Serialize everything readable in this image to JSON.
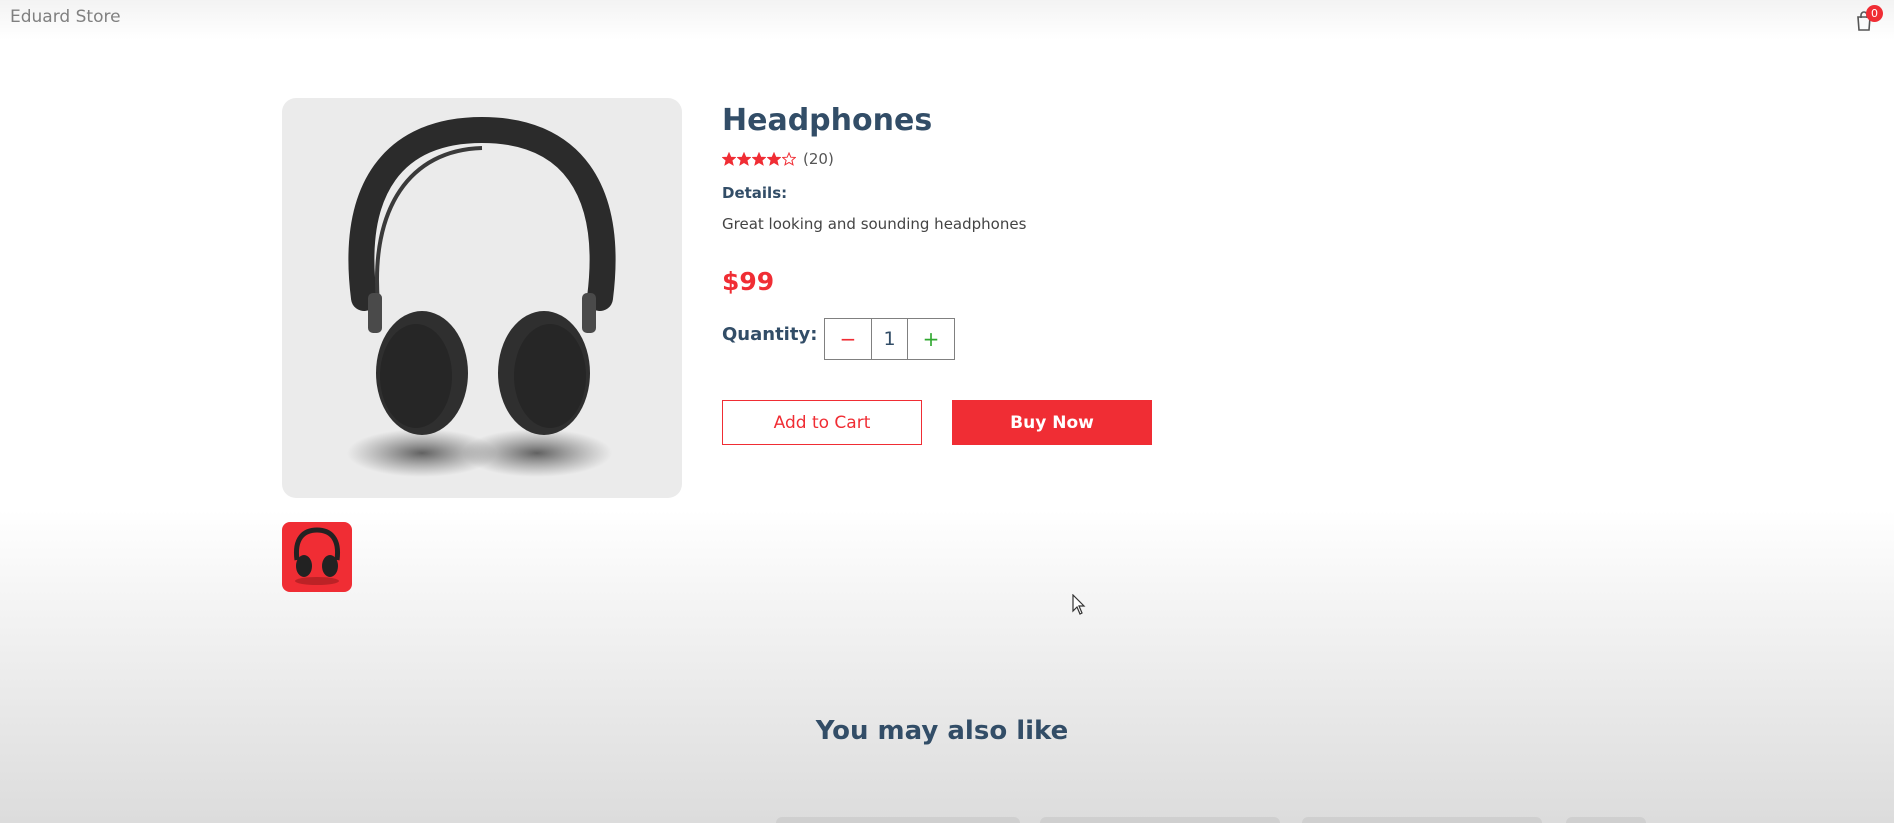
{
  "store": {
    "name": "Eduard Store",
    "cart_count": "0"
  },
  "product": {
    "name": "Headphones",
    "rating": 4,
    "rating_max": 5,
    "review_count": "(20)",
    "details_label": "Details:",
    "details": "Great looking and sounding headphones",
    "price": "$99"
  },
  "quantity": {
    "label": "Quantity:",
    "minus": "−",
    "value": "1",
    "plus": "+"
  },
  "actions": {
    "add_to_cart": "Add to Cart",
    "buy_now": "Buy Now"
  },
  "section": {
    "also_like_title": "You may also like"
  },
  "colors": {
    "accent": "#f02d34",
    "text": "#324d67",
    "plus": "#31a831"
  }
}
